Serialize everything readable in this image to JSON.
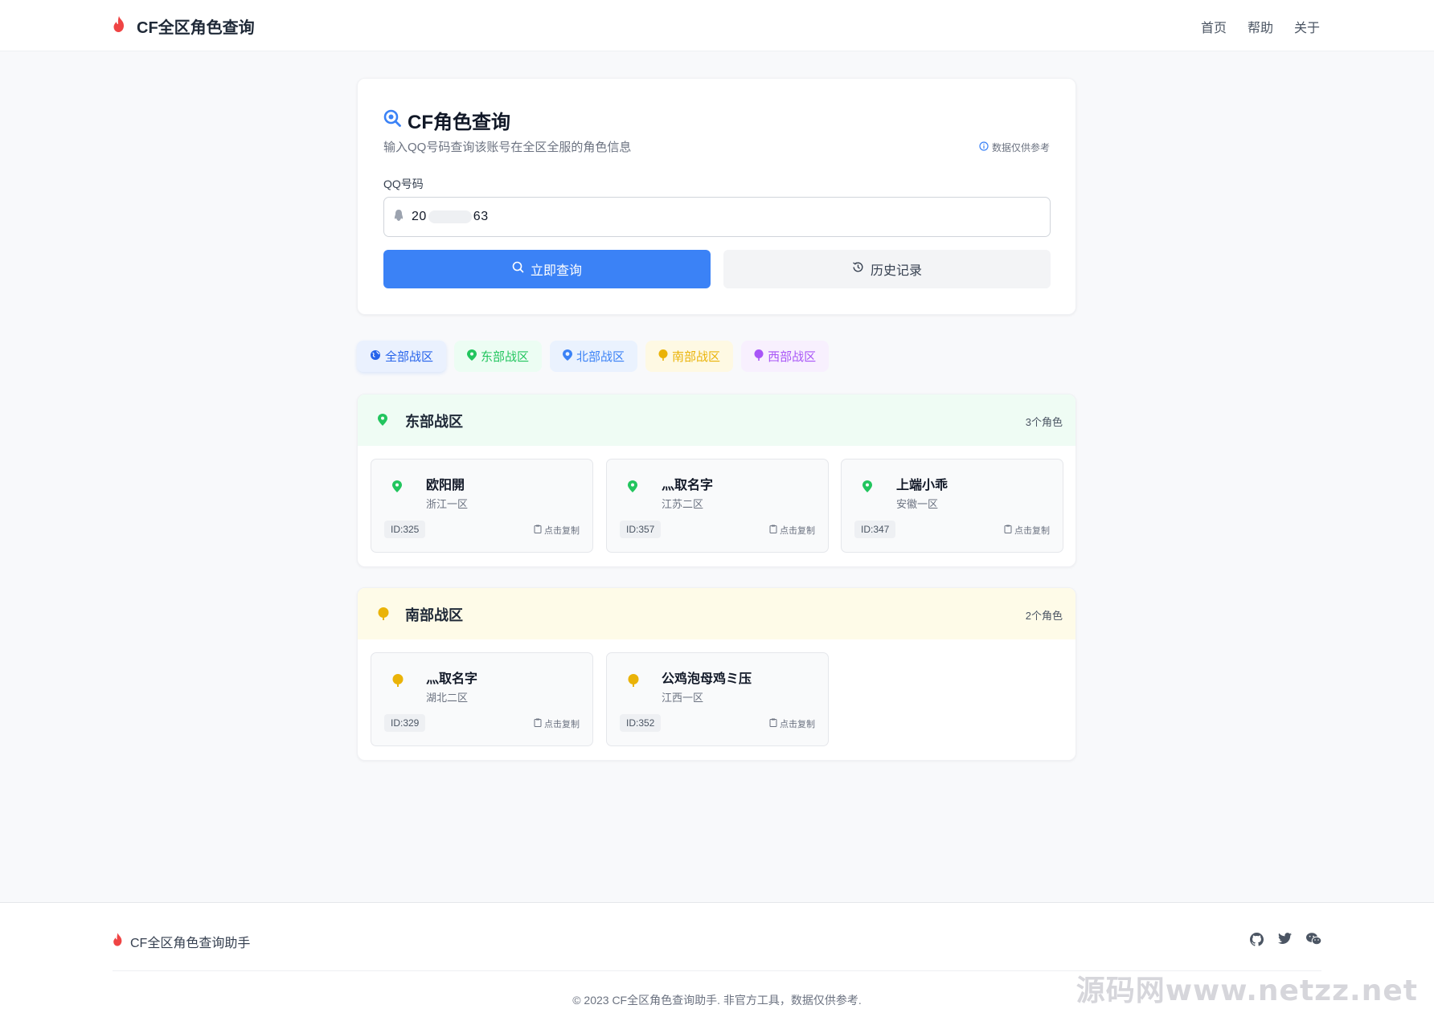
{
  "header": {
    "brand": "CF全区角色查询",
    "nav": [
      "首页",
      "帮助",
      "关于"
    ]
  },
  "query": {
    "title": "CF角色查询",
    "subtitle": "输入QQ号码查询该账号在全区全服的角色信息",
    "note": "数据仅供参考",
    "label": "QQ号码",
    "input_prefix": "20",
    "input_suffix": "63",
    "search_button": "立即查询",
    "history_button": "历史记录"
  },
  "tabs": [
    "全部战区",
    "东部战区",
    "北部战区",
    "南部战区",
    "西部战区"
  ],
  "regions": [
    {
      "name": "东部战区",
      "count": "3个角色",
      "color": "#22c55e",
      "roles": [
        {
          "name": "欧阳開",
          "server": "浙江一区",
          "id": "ID:325",
          "copy": "点击复制"
        },
        {
          "name": "灬取名字",
          "server": "江苏二区",
          "id": "ID:357",
          "copy": "点击复制"
        },
        {
          "name": "上端小乖",
          "server": "安徽一区",
          "id": "ID:347",
          "copy": "点击复制"
        }
      ]
    },
    {
      "name": "南部战区",
      "count": "2个角色",
      "color": "#eab308",
      "roles": [
        {
          "name": "灬取名字",
          "server": "湖北二区",
          "id": "ID:329",
          "copy": "点击复制"
        },
        {
          "name": "公鸡泡母鸡ミ压",
          "server": "江西一区",
          "id": "ID:352",
          "copy": "点击复制"
        }
      ]
    }
  ],
  "footer": {
    "brand": "CF全区角色查询助手",
    "copyright": "© 2023 CF全区角色查询助手. 非官方工具，数据仅供参考.",
    "watermark": "源码网www.netzz.net"
  }
}
